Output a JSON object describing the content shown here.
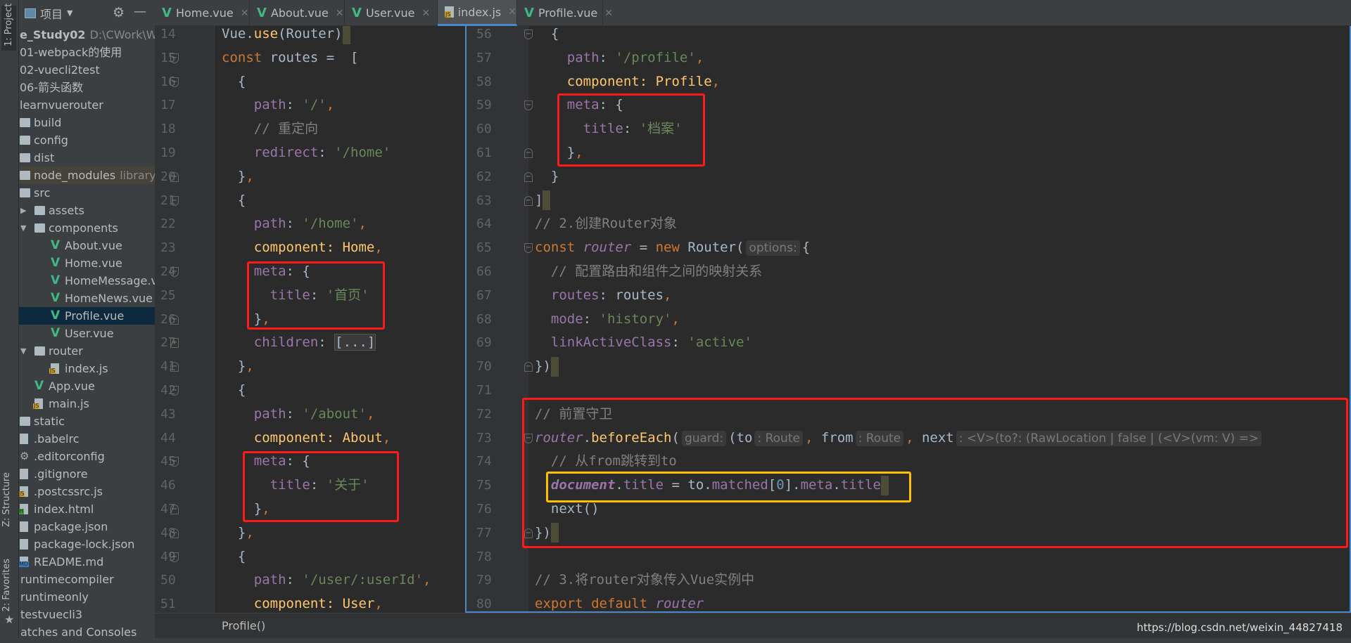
{
  "colors": {
    "background": "#2b2b2b",
    "keyword": "#cc7832",
    "string": "#6a8759",
    "property": "#9876aa",
    "comment": "#808080",
    "highlight_red": "#ff1a1a",
    "highlight_yellow": "#ffc000",
    "active_tab": "#4a88c7"
  },
  "tool_strip": {
    "project": "1: Project",
    "structure": "Z: Structure",
    "favorites": "2: Favorites"
  },
  "project": {
    "header": "项目",
    "items": [
      {
        "label": "e_Study02",
        "sub": "D:\\CWork\\Web",
        "depth": 0,
        "bold": true
      },
      {
        "label": "01-webpack的使用",
        "depth": 0
      },
      {
        "label": "02-vuecli2test",
        "depth": 0
      },
      {
        "label": "06-箭头函数",
        "depth": 0
      },
      {
        "label": "learnvuerouter",
        "depth": 0
      },
      {
        "label": "build",
        "depth": 0,
        "icon": "folder"
      },
      {
        "label": "config",
        "depth": 0,
        "icon": "folder"
      },
      {
        "label": "dist",
        "depth": 0,
        "icon": "folder"
      },
      {
        "label": "node_modules",
        "sub": "library r",
        "depth": 0,
        "icon": "folder",
        "excluded": true
      },
      {
        "label": "src",
        "depth": 0,
        "icon": "folder"
      },
      {
        "label": "assets",
        "depth": 0,
        "icon": "folder",
        "arrow": "right"
      },
      {
        "label": "components",
        "depth": 0,
        "icon": "folder",
        "arrow": "down"
      },
      {
        "label": "About.vue",
        "depth": 2,
        "icon": "vue"
      },
      {
        "label": "Home.vue",
        "depth": 2,
        "icon": "vue"
      },
      {
        "label": "HomeMessage.vue",
        "depth": 2,
        "icon": "vue"
      },
      {
        "label": "HomeNews.vue",
        "depth": 2,
        "icon": "vue"
      },
      {
        "label": "Profile.vue",
        "depth": 2,
        "icon": "vue",
        "selected": true
      },
      {
        "label": "User.vue",
        "depth": 2,
        "icon": "vue"
      },
      {
        "label": "router",
        "depth": 0,
        "icon": "folder",
        "arrow": "down"
      },
      {
        "label": "index.js",
        "depth": 2,
        "icon": "js"
      },
      {
        "label": "App.vue",
        "depth": 1,
        "icon": "vue"
      },
      {
        "label": "main.js",
        "depth": 1,
        "icon": "js"
      },
      {
        "label": "static",
        "depth": 0,
        "icon": "folder"
      },
      {
        "label": ".babelrc",
        "depth": 0,
        "icon": "config"
      },
      {
        "label": ".editorconfig",
        "depth": 0,
        "icon": "gear"
      },
      {
        "label": ".gitignore",
        "depth": 0,
        "icon": "file"
      },
      {
        "label": ".postcssrc.js",
        "depth": 0,
        "icon": "js"
      },
      {
        "label": "index.html",
        "depth": 0,
        "icon": "html"
      },
      {
        "label": "package.json",
        "depth": 0,
        "icon": "config"
      },
      {
        "label": "package-lock.json",
        "depth": 0,
        "icon": "config"
      },
      {
        "label": "README.md",
        "depth": 0,
        "icon": "md"
      },
      {
        "label": "runtimecompiler",
        "depth": -1
      },
      {
        "label": "runtimeonly",
        "depth": -1
      },
      {
        "label": "testvuecli3",
        "depth": -1
      },
      {
        "label": "atches and Consoles",
        "depth": -1
      }
    ]
  },
  "tabs": [
    {
      "label": "Home.vue",
      "icon": "vue"
    },
    {
      "label": "About.vue",
      "icon": "vue"
    },
    {
      "label": "User.vue",
      "icon": "vue"
    },
    {
      "label": "index.js",
      "icon": "js",
      "active": true
    },
    {
      "label": "Profile.vue",
      "icon": "vue"
    }
  ],
  "editor_left": [
    {
      "n": "14",
      "t": [
        [
          "Vue.",
          ""
        ],
        [
          "use",
          "fn"
        ],
        [
          "(Router)",
          ""
        ]
      ],
      "mark": true
    },
    {
      "n": "15",
      "f": "open",
      "t": [
        [
          "const",
          "kw"
        ],
        [
          " routes =  [",
          ""
        ]
      ]
    },
    {
      "n": "16",
      "f": "open",
      "t": [
        [
          "  {",
          ""
        ]
      ]
    },
    {
      "n": "17",
      "t": [
        [
          "    ",
          ""
        ],
        [
          "path",
          "prop"
        ],
        [
          ": ",
          ""
        ],
        [
          "'/'",
          "str"
        ],
        [
          ",",
          "kw"
        ]
      ]
    },
    {
      "n": "18",
      "t": [
        [
          "    // 重定向",
          "cm"
        ]
      ]
    },
    {
      "n": "19",
      "t": [
        [
          "    ",
          ""
        ],
        [
          "redirect",
          "prop"
        ],
        [
          ": ",
          ""
        ],
        [
          "'/home'",
          "str"
        ]
      ]
    },
    {
      "n": "20",
      "f": "close",
      "t": [
        [
          "  }",
          ""
        ],
        [
          ",",
          "kw"
        ]
      ]
    },
    {
      "n": "21",
      "f": "open",
      "t": [
        [
          "  {",
          ""
        ]
      ]
    },
    {
      "n": "22",
      "t": [
        [
          "    ",
          ""
        ],
        [
          "path",
          "prop"
        ],
        [
          ": ",
          ""
        ],
        [
          "'/home'",
          "str"
        ],
        [
          ",",
          "kw"
        ]
      ]
    },
    {
      "n": "23",
      "t": [
        [
          "    ",
          ""
        ],
        [
          "component: Home",
          "fn"
        ],
        [
          ",",
          "kw"
        ]
      ]
    },
    {
      "n": "24",
      "f": "open",
      "t": [
        [
          "    ",
          ""
        ],
        [
          "meta",
          "prop"
        ],
        [
          ": {",
          ""
        ]
      ]
    },
    {
      "n": "25",
      "t": [
        [
          "      ",
          ""
        ],
        [
          "title",
          "prop"
        ],
        [
          ": ",
          ""
        ],
        [
          "'首页'",
          "str"
        ]
      ]
    },
    {
      "n": "26",
      "f": "close",
      "t": [
        [
          "    }",
          ""
        ],
        [
          ",",
          "kw"
        ]
      ]
    },
    {
      "n": "27",
      "f": "expand",
      "t": [
        [
          "    ",
          ""
        ],
        [
          "children",
          "prop"
        ],
        [
          ": ",
          ""
        ],
        [
          "[...]",
          "ph"
        ]
      ]
    },
    {
      "n": "41",
      "f": "close",
      "t": [
        [
          "  }",
          ""
        ],
        [
          ",",
          "kw"
        ]
      ]
    },
    {
      "n": "42",
      "f": "open",
      "t": [
        [
          "  {",
          ""
        ]
      ]
    },
    {
      "n": "43",
      "t": [
        [
          "    ",
          ""
        ],
        [
          "path",
          "prop"
        ],
        [
          ": ",
          ""
        ],
        [
          "'/about'",
          "str"
        ],
        [
          ",",
          "kw"
        ]
      ]
    },
    {
      "n": "44",
      "t": [
        [
          "    ",
          ""
        ],
        [
          "component: About",
          "fn"
        ],
        [
          ",",
          "kw"
        ]
      ]
    },
    {
      "n": "45",
      "f": "open",
      "t": [
        [
          "    ",
          ""
        ],
        [
          "meta",
          "prop"
        ],
        [
          ": {",
          ""
        ]
      ]
    },
    {
      "n": "46",
      "t": [
        [
          "      ",
          ""
        ],
        [
          "title",
          "prop"
        ],
        [
          ": ",
          ""
        ],
        [
          "'关于'",
          "str"
        ]
      ]
    },
    {
      "n": "47",
      "f": "close",
      "t": [
        [
          "    }",
          ""
        ],
        [
          ",",
          "kw"
        ]
      ]
    },
    {
      "n": "48",
      "f": "close",
      "t": [
        [
          "  }",
          ""
        ],
        [
          ",",
          "kw"
        ]
      ]
    },
    {
      "n": "49",
      "f": "open",
      "t": [
        [
          "  {",
          ""
        ]
      ]
    },
    {
      "n": "50",
      "t": [
        [
          "    ",
          ""
        ],
        [
          "path",
          "prop"
        ],
        [
          ": ",
          ""
        ],
        [
          "'/user/:userId'",
          "str"
        ],
        [
          ",",
          "kw"
        ]
      ]
    },
    {
      "n": "51",
      "t": [
        [
          "    ",
          ""
        ],
        [
          "component: User",
          "fn"
        ],
        [
          ",",
          "kw"
        ]
      ]
    }
  ],
  "editor_right": [
    {
      "n": "56",
      "f": "open",
      "t": [
        [
          "  {",
          ""
        ]
      ]
    },
    {
      "n": "57",
      "t": [
        [
          "    ",
          ""
        ],
        [
          "path",
          "prop"
        ],
        [
          ": ",
          ""
        ],
        [
          "'/profile'",
          "str"
        ],
        [
          ",",
          "kw"
        ]
      ]
    },
    {
      "n": "58",
      "t": [
        [
          "    ",
          ""
        ],
        [
          "component: Profile",
          "fn"
        ],
        [
          ",",
          "kw"
        ]
      ]
    },
    {
      "n": "59",
      "f": "open",
      "t": [
        [
          "    ",
          ""
        ],
        [
          "meta",
          "prop"
        ],
        [
          ": {",
          ""
        ]
      ]
    },
    {
      "n": "60",
      "t": [
        [
          "      ",
          ""
        ],
        [
          "title",
          "prop"
        ],
        [
          ": ",
          ""
        ],
        [
          "'档案'",
          "str"
        ]
      ]
    },
    {
      "n": "61",
      "f": "close",
      "t": [
        [
          "    }",
          ""
        ],
        [
          ",",
          "kw"
        ]
      ]
    },
    {
      "n": "62",
      "f": "close",
      "t": [
        [
          "  }",
          ""
        ]
      ]
    },
    {
      "n": "63",
      "f": "close",
      "t": [
        [
          "]",
          ""
        ]
      ],
      "mark": true
    },
    {
      "n": "64",
      "t": [
        [
          "// 2.创建Router对象",
          "cm"
        ]
      ]
    },
    {
      "n": "65",
      "f": "open",
      "t": [
        [
          "const ",
          "kw"
        ],
        [
          "router",
          "ivar"
        ],
        [
          " = ",
          ""
        ],
        [
          "new ",
          "kw"
        ],
        [
          "Router(",
          ""
        ],
        [
          "options:",
          "hint"
        ],
        [
          "{",
          ""
        ]
      ]
    },
    {
      "n": "66",
      "t": [
        [
          "  // 配置路由和组件之间的映射关系",
          "cm"
        ]
      ]
    },
    {
      "n": "67",
      "t": [
        [
          "  ",
          ""
        ],
        [
          "routes",
          "prop"
        ],
        [
          ": routes",
          ""
        ],
        [
          ",",
          "kw"
        ]
      ]
    },
    {
      "n": "68",
      "t": [
        [
          "  ",
          ""
        ],
        [
          "mode",
          "prop"
        ],
        [
          ": ",
          ""
        ],
        [
          "'history'",
          "str"
        ],
        [
          ",",
          "kw"
        ]
      ]
    },
    {
      "n": "69",
      "t": [
        [
          "  ",
          ""
        ],
        [
          "linkActiveClass",
          "prop"
        ],
        [
          ": ",
          ""
        ],
        [
          "'active'",
          "str"
        ]
      ]
    },
    {
      "n": "70",
      "f": "close",
      "t": [
        [
          "})",
          ""
        ]
      ],
      "mark": true
    },
    {
      "n": "71",
      "t": []
    },
    {
      "n": "72",
      "t": [
        [
          "// 前置守卫",
          "cm"
        ]
      ]
    },
    {
      "n": "73",
      "f": "open",
      "t": [
        [
          "router",
          "ivar"
        ],
        [
          ".",
          ""
        ],
        [
          "beforeEach",
          "fn"
        ],
        [
          "(",
          ""
        ],
        [
          "guard:",
          "hint"
        ],
        [
          "(to",
          ""
        ],
        [
          ": Route",
          "hint"
        ],
        [
          ",",
          "kw"
        ],
        [
          " from",
          ""
        ],
        [
          ": Route",
          "hint"
        ],
        [
          ",",
          "kw"
        ],
        [
          " next",
          ""
        ],
        [
          ": <V>(to?: (RawLocation | false | (<V>(vm: V) =>",
          "hint"
        ]
      ]
    },
    {
      "n": "74",
      "t": [
        [
          "  // 从from跳转到to",
          "cm"
        ]
      ]
    },
    {
      "n": "75",
      "t": [
        [
          "  ",
          ""
        ],
        [
          "document",
          "ibold"
        ],
        [
          ".",
          ""
        ],
        [
          "title",
          "prop"
        ],
        [
          " = to.",
          ""
        ],
        [
          "matched",
          "prop"
        ],
        [
          "[",
          ""
        ],
        [
          "0",
          "num"
        ],
        [
          "].",
          ""
        ],
        [
          "meta",
          "prop"
        ],
        [
          ".",
          ""
        ],
        [
          "title",
          "prop"
        ]
      ],
      "mark": true
    },
    {
      "n": "76",
      "t": [
        [
          "  next()",
          ""
        ]
      ]
    },
    {
      "n": "77",
      "f": "close",
      "t": [
        [
          "})",
          ""
        ]
      ],
      "mark": true
    },
    {
      "n": "78",
      "t": []
    },
    {
      "n": "79",
      "t": [
        [
          "// 3.将router对象传入Vue实例中",
          "cm"
        ]
      ]
    },
    {
      "n": "80",
      "t": [
        [
          "export default ",
          "kw"
        ],
        [
          "router",
          "ivar"
        ]
      ]
    }
  ],
  "breadcrumb": "Profile()",
  "watermark": "https://blog.csdn.net/weixin_44827418"
}
